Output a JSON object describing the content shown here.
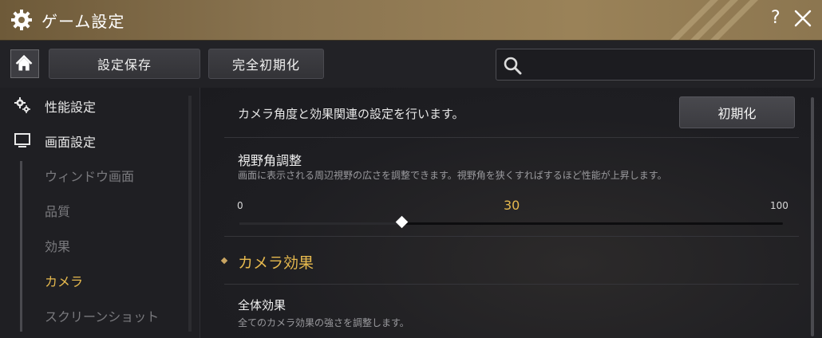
{
  "window": {
    "title": "ゲーム設定",
    "help_label": "?"
  },
  "toolbar": {
    "save_label": "設定保存",
    "reset_all_label": "完全初期化",
    "search_placeholder": ""
  },
  "sidebar": {
    "categories": [
      {
        "label": "性能設定",
        "icon": "gears-icon"
      },
      {
        "label": "画面設定",
        "icon": "monitor-icon"
      }
    ],
    "sub_items": [
      {
        "label": "ウィンドウ画面",
        "active": false
      },
      {
        "label": "品質",
        "active": false
      },
      {
        "label": "効果",
        "active": false
      },
      {
        "label": "カメラ",
        "active": true
      },
      {
        "label": "スクリーンショット",
        "active": false
      }
    ]
  },
  "main": {
    "description": "カメラ角度と効果関連の設定を行います。",
    "reset_label": "初期化",
    "fov": {
      "title": "視野角調整",
      "description": "画面に表示される周辺視野の広さを調整できます。視野角を狭くすればするほど性能が上昇します。",
      "min": "0",
      "max": "100",
      "value": "30",
      "value_fraction": 0.3
    },
    "section_title": "カメラ効果",
    "overall": {
      "title": "全体効果",
      "description": "全てのカメラ効果の強さを調整します。"
    }
  },
  "colors": {
    "accent": "#e6b94e",
    "title_bar": "#8a7450"
  }
}
